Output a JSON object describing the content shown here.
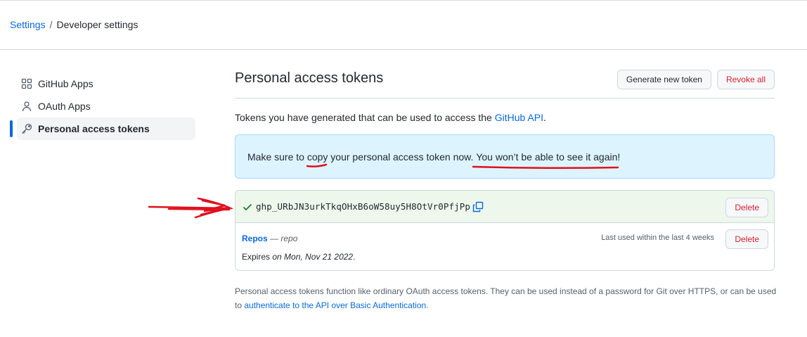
{
  "breadcrumb": {
    "root": "Settings",
    "separator": "/",
    "current": "Developer settings"
  },
  "sidebar": {
    "items": [
      {
        "label": "GitHub Apps",
        "icon": "apps-icon"
      },
      {
        "label": "OAuth Apps",
        "icon": "person-icon"
      },
      {
        "label": "Personal access tokens",
        "icon": "key-icon",
        "active": true
      }
    ]
  },
  "main": {
    "title": "Personal access tokens",
    "generate_label": "Generate new token",
    "revoke_label": "Revoke all",
    "desc_prefix": "Tokens you have generated that can be used to access the ",
    "desc_link": "GitHub API",
    "desc_suffix": ".",
    "flash": {
      "part1": "Make sure to ",
      "copy_word": "copy",
      "part2": " your personal access token now. ",
      "warning": "You won’t be able to see it again!"
    },
    "new_token": {
      "value": "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",
      "delete_label": "Delete"
    },
    "token": {
      "name": "Repos",
      "dash": "—",
      "scope": "repo",
      "last_used": "Last used within the last 4 weeks",
      "expires_prefix": "Expires ",
      "expires_value": "on Mon, Nov 21 2022",
      "expires_suffix": ".",
      "delete_label": "Delete"
    },
    "footer": {
      "text": "Personal access tokens function like ordinary OAuth access tokens. They can be used instead of a password for Git over HTTPS, or can be used to ",
      "link": "authenticate to the API over Basic Authentication",
      "suffix": "."
    }
  },
  "colors": {
    "accent": "#0969da",
    "danger": "#cf222e",
    "success": "#1a7f37",
    "flash_bg": "#ddf4ff",
    "annotation": "#e0101e"
  }
}
